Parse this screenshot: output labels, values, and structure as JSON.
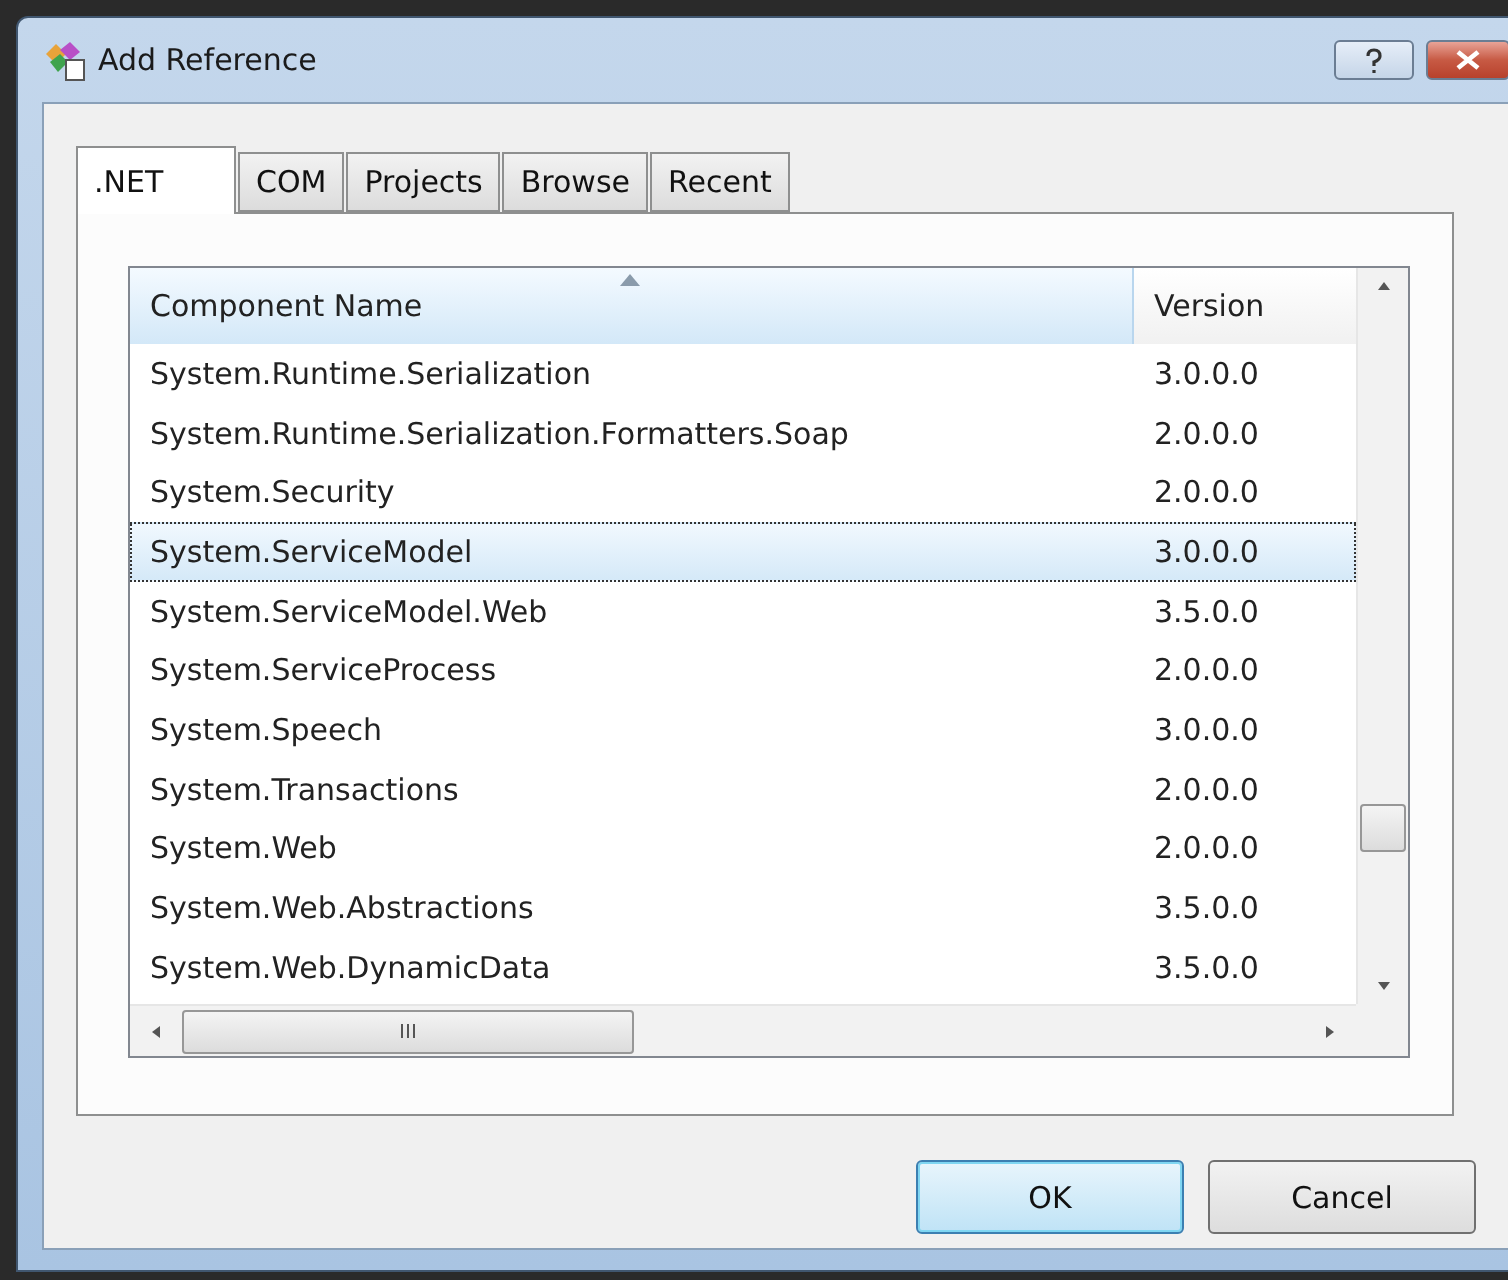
{
  "window": {
    "title": "Add Reference"
  },
  "tabs": [
    {
      "label": ".NET",
      "selected": true
    },
    {
      "label": "COM",
      "selected": false
    },
    {
      "label": "Projects",
      "selected": false
    },
    {
      "label": "Browse",
      "selected": false
    },
    {
      "label": "Recent",
      "selected": false
    }
  ],
  "table": {
    "columns": [
      {
        "label": "Component Name",
        "sorted": true
      },
      {
        "label": "Version",
        "sorted": false
      }
    ],
    "rows": [
      {
        "name": "System.Runtime.Serialization",
        "version": "3.0.0.0",
        "selected": false
      },
      {
        "name": "System.Runtime.Serialization.Formatters.Soap",
        "version": "2.0.0.0",
        "selected": false
      },
      {
        "name": "System.Security",
        "version": "2.0.0.0",
        "selected": false
      },
      {
        "name": "System.ServiceModel",
        "version": "3.0.0.0",
        "selected": true
      },
      {
        "name": "System.ServiceModel.Web",
        "version": "3.5.0.0",
        "selected": false
      },
      {
        "name": "System.ServiceProcess",
        "version": "2.0.0.0",
        "selected": false
      },
      {
        "name": "System.Speech",
        "version": "3.0.0.0",
        "selected": false
      },
      {
        "name": "System.Transactions",
        "version": "2.0.0.0",
        "selected": false
      },
      {
        "name": "System.Web",
        "version": "2.0.0.0",
        "selected": false
      },
      {
        "name": "System.Web.Abstractions",
        "version": "3.5.0.0",
        "selected": false
      },
      {
        "name": "System.Web.DynamicData",
        "version": "3.5.0.0",
        "selected": false
      }
    ]
  },
  "buttons": [
    {
      "label": "OK",
      "default": true
    },
    {
      "label": "Cancel",
      "default": false
    }
  ]
}
